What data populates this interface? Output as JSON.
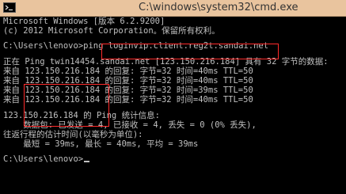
{
  "window": {
    "title": "C:\\windows\\system32\\cmd.exe"
  },
  "console": {
    "header": [
      "Microsoft Windows [版本 6.2.9200]",
      "(c) 2012 Microsoft Corporation。保留所有权利。"
    ],
    "prompt": "C:\\Users\\lenovo>",
    "command_name": "ping",
    "command_arg": "loginvip.client.reg2t.sandai.net",
    "ping_header": "正在 Ping twin14454.sandai.net [123.150.216.184] 具有 32 字节的数据:",
    "replies": [
      {
        "prefix": "来自",
        "ip": "123.150.216.184",
        "text": "的回复: 字节=32 时间=40ms TTL=50"
      },
      {
        "prefix": "来自",
        "ip": "123.150.216.184",
        "text": "的回复: 字节=32 时间=40ms TTL=50"
      },
      {
        "prefix": "来自",
        "ip": "123.150.216.184",
        "text": "的回复: 字节=32 时间=39ms TTL=50"
      },
      {
        "prefix": "来自",
        "ip": "123.150.216.184",
        "text": "的回复: 字节=32 时间=40ms TTL=50"
      }
    ],
    "stats_title": "123.150.216.184 的 Ping 统计信息:",
    "stats_packets": "    数据包: 已发送 = 4, 已接收 = 4, 丢失 = 0 (0% 丢失),",
    "stats_rtt_title": "往返行程的估计时间(以毫秒为单位):",
    "stats_rtt": "    最短 = 39ms, 最长 = 40ms, 平均 = 39ms",
    "final_prompt": "C:\\Users\\lenovo>"
  }
}
